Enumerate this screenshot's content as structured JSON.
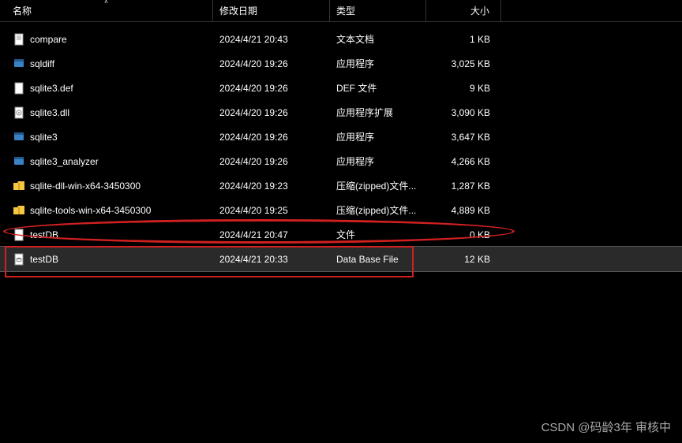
{
  "columns": {
    "name": "名称",
    "date": "修改日期",
    "type": "类型",
    "size": "大小"
  },
  "files": [
    {
      "icon": "text-file",
      "name": "compare",
      "date": "2024/4/21 20:43",
      "type": "文本文档",
      "size": "1 KB"
    },
    {
      "icon": "exe-file",
      "name": "sqldiff",
      "date": "2024/4/20 19:26",
      "type": "应用程序",
      "size": "3,025 KB"
    },
    {
      "icon": "def-file",
      "name": "sqlite3.def",
      "date": "2024/4/20 19:26",
      "type": "DEF 文件",
      "size": "9 KB"
    },
    {
      "icon": "dll-file",
      "name": "sqlite3.dll",
      "date": "2024/4/20 19:26",
      "type": "应用程序扩展",
      "size": "3,090 KB"
    },
    {
      "icon": "exe-file",
      "name": "sqlite3",
      "date": "2024/4/20 19:26",
      "type": "应用程序",
      "size": "3,647 KB"
    },
    {
      "icon": "exe-file",
      "name": "sqlite3_analyzer",
      "date": "2024/4/20 19:26",
      "type": "应用程序",
      "size": "4,266 KB"
    },
    {
      "icon": "zip-folder",
      "name": "sqlite-dll-win-x64-3450300",
      "date": "2024/4/20 19:23",
      "type": "压缩(zipped)文件...",
      "size": "1,287 KB"
    },
    {
      "icon": "zip-folder",
      "name": "sqlite-tools-win-x64-3450300",
      "date": "2024/4/20 19:25",
      "type": "压缩(zipped)文件...",
      "size": "4,889 KB"
    },
    {
      "icon": "blank-file",
      "name": "testDB",
      "date": "2024/4/21 20:47",
      "type": "文件",
      "size": "0 KB"
    },
    {
      "icon": "db-file",
      "name": "testDB",
      "date": "2024/4/21 20:33",
      "type": "Data Base File",
      "size": "12 KB"
    }
  ],
  "selected_index": 9,
  "watermark": "CSDN @码龄3年 审核中"
}
